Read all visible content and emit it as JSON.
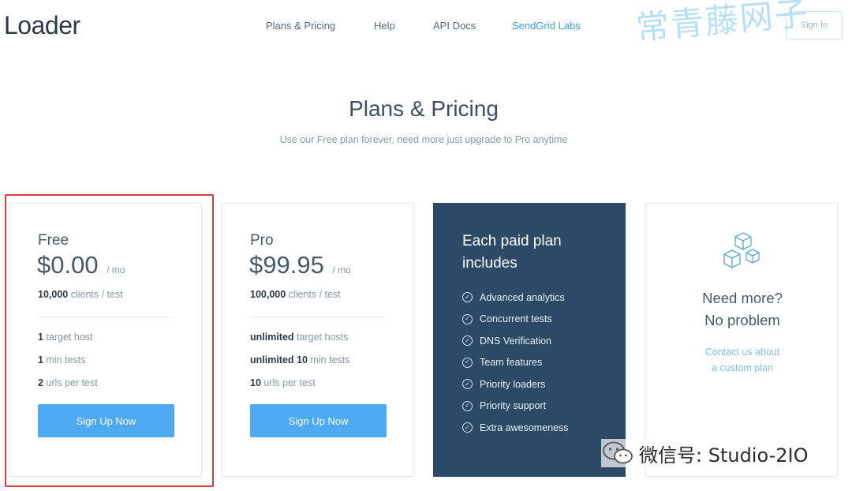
{
  "brand": {
    "logo": "Loader"
  },
  "nav": {
    "items": [
      {
        "label": "Plans & Pricing"
      },
      {
        "label": "Help"
      },
      {
        "label": "API Docs"
      },
      {
        "label": "SendGrid Labs"
      }
    ],
    "sign_in": "Sign In"
  },
  "watermarks": {
    "top": "常青藤网子",
    "bottom": "微信号: Studio-2IO"
  },
  "header": {
    "title": "Plans & Pricing",
    "subtitle": "Use our Free plan forever, need more just upgrade to Pro anytime"
  },
  "plans": [
    {
      "name": "Free",
      "price": "$0.00",
      "period": "/ mo",
      "clients_value": "10,000",
      "clients_text": " clients / test",
      "features": [
        {
          "value": "1",
          "text": " target host"
        },
        {
          "value": "1",
          "text": " min tests"
        },
        {
          "value": "2",
          "text": " urls per test"
        }
      ],
      "button": "Sign Up Now"
    },
    {
      "name": "Pro",
      "price": "$99.95",
      "period": "/ mo",
      "clients_value": "100,000",
      "clients_text": " clients / test",
      "features": [
        {
          "value": "unlimited",
          "text": " target hosts"
        },
        {
          "value": "unlimited 10",
          "text": " min tests"
        },
        {
          "value": "10",
          "text": " urls per test"
        }
      ],
      "button": "Sign Up Now"
    }
  ],
  "paid": {
    "title": "Each paid plan includes",
    "items": [
      "Advanced analytics",
      "Concurrent tests",
      "DNS Verification",
      "Team features",
      "Priority loaders",
      "Priority support",
      "Extra awesomeness"
    ]
  },
  "more": {
    "title_line1": "Need more?",
    "title_line2": "No problem",
    "link_line1": "Contact us about",
    "link_line2": "a custom plan"
  },
  "colors": {
    "accent": "#4daaf2",
    "dark_panel": "#2c4a66",
    "link": "#3aa0e6",
    "highlight": "#e03a3a"
  }
}
